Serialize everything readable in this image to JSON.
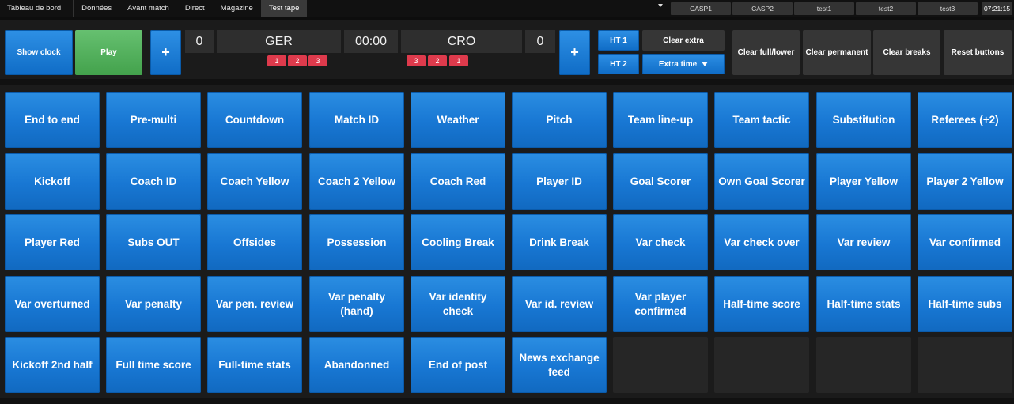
{
  "nav": {
    "tabs": [
      "Tableau de bord",
      "Données",
      "Avant match",
      "Direct",
      "Magazine",
      "Test tape"
    ],
    "active_tab": "Test tape",
    "chips": [
      "CASP1",
      "CASP2",
      "test1",
      "test2",
      "test3"
    ],
    "clock": "07:21:15"
  },
  "controls": {
    "show_clock": "Show clock",
    "play": "Play",
    "plus": "+",
    "home": {
      "score": "0",
      "name": "GER",
      "periods": [
        "1",
        "2",
        "3"
      ]
    },
    "time": "00:00",
    "away": {
      "score": "0",
      "name": "CRO",
      "periods": [
        "3",
        "2",
        "1"
      ]
    },
    "ht1": "HT 1",
    "ht2": "HT 2",
    "clear_extra": "Clear extra",
    "extra_time": "Extra time",
    "clear_full_lower": "Clear full/lower",
    "clear_permanent": "Clear permanent",
    "clear_breaks": "Clear breaks",
    "reset_buttons": "Reset buttons"
  },
  "graphics": [
    [
      "End to end",
      "Pre-multi",
      "Countdown",
      "Match ID",
      "Weather",
      "Pitch",
      "Team line-up",
      "Team tactic",
      "Substitution",
      "Referees (+2)"
    ],
    [
      "Kickoff",
      "Coach ID",
      "Coach Yellow",
      "Coach 2 Yellow",
      "Coach Red",
      "Player ID",
      "Goal Scorer",
      "Own Goal Scorer",
      "Player Yellow",
      "Player 2 Yellow"
    ],
    [
      "Player Red",
      "Subs OUT",
      "Offsides",
      "Possession",
      "Cooling Break",
      "Drink Break",
      "Var check",
      "Var check over",
      "Var review",
      "Var confirmed"
    ],
    [
      "Var overturned",
      "Var penalty",
      "Var pen. review",
      "Var penalty (hand)",
      "Var identity check",
      "Var id. review",
      "Var player confirmed",
      "Half-time score",
      "Half-time stats",
      "Half-time subs"
    ],
    [
      "Kickoff 2nd half",
      "Full time score",
      "Full-time stats",
      "Abandonned",
      "End of post",
      "News exchange feed",
      "",
      "",
      "",
      ""
    ]
  ],
  "colors": {
    "button_blue": "#1877d3",
    "play_green": "#4fae58",
    "period_red": "#de3a4c",
    "background": "#1b1b1b"
  }
}
